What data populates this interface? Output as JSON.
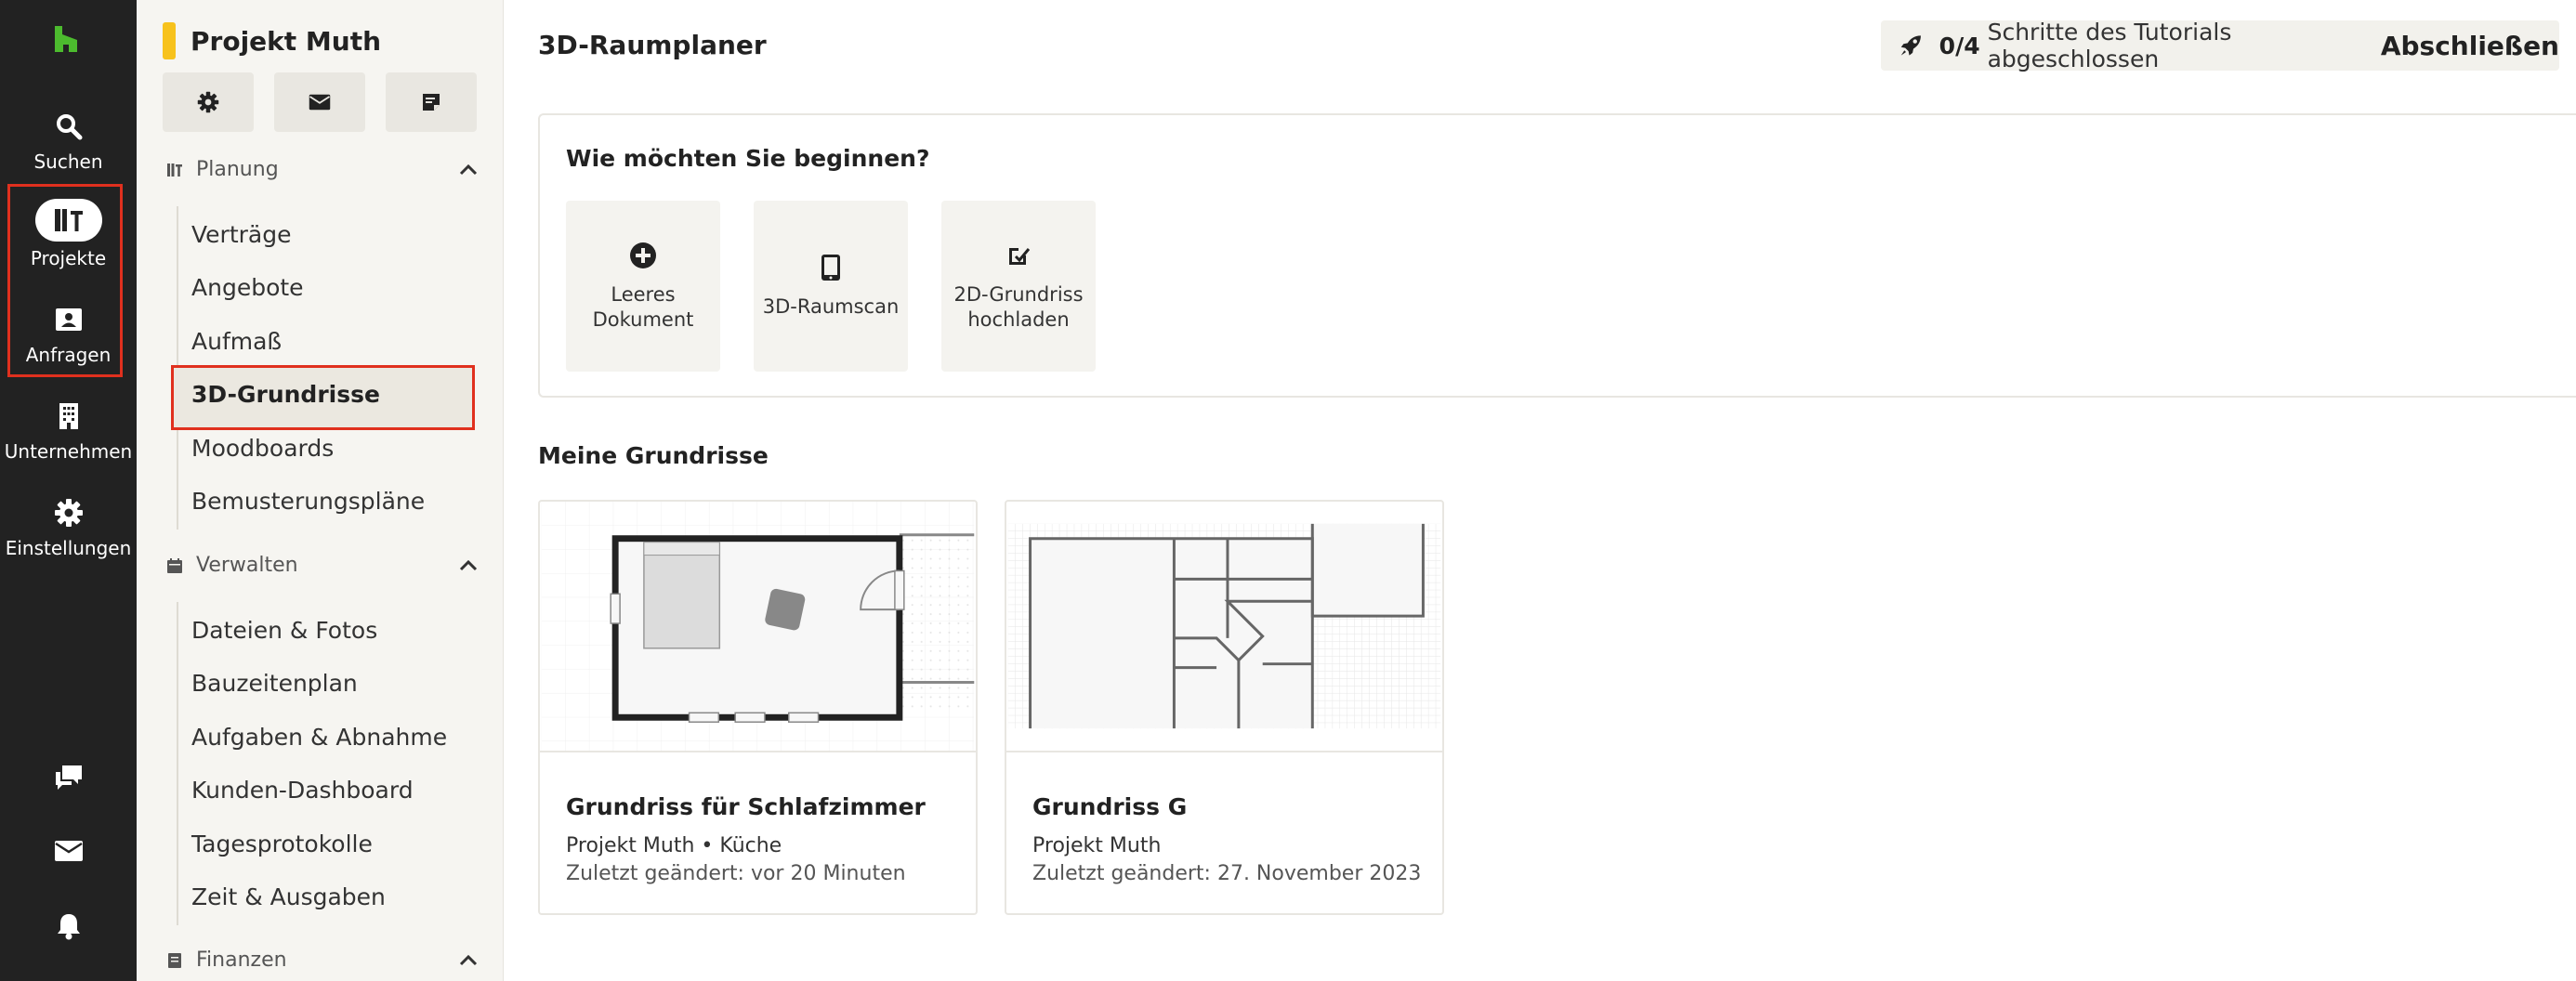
{
  "rail": {
    "items": [
      {
        "label": "Suchen",
        "icon": "search-icon"
      },
      {
        "label": "Projekte",
        "icon": "projects-icon"
      },
      {
        "label": "Anfragen",
        "icon": "inbox-person-icon"
      },
      {
        "label": "Unternehmen",
        "icon": "building-icon"
      },
      {
        "label": "Einstellungen",
        "icon": "gear-icon"
      }
    ],
    "bottom_icons": [
      "chat-icon",
      "mail-icon",
      "bell-icon"
    ],
    "logo_color": "#4cbb2e",
    "highlight_color": "#e0301e"
  },
  "sidebar": {
    "project_name": "Projekt Muth",
    "project_color": "#f7c21c",
    "sections": [
      {
        "title": "Planung",
        "items": [
          "Verträge",
          "Angebote",
          "Aufmaß",
          "3D-Grundrisse",
          "Moodboards",
          "Bemusterungspläne"
        ]
      },
      {
        "title": "Verwalten",
        "items": [
          "Dateien & Fotos",
          "Bauzeitenplan",
          "Aufgaben & Abnahme",
          "Kunden-Dashboard",
          "Tagesprotokolle",
          "Zeit & Ausgaben"
        ]
      },
      {
        "title": "Finanzen",
        "items": []
      }
    ],
    "active_item": "3D-Grundrisse"
  },
  "main": {
    "title": "3D-Raumplaner",
    "tutorial": {
      "count": "0/4",
      "text": "Schritte des Tutorials abgeschlossen",
      "finish": "Abschließen"
    },
    "start": {
      "title": "Wie möchten Sie beginnen?",
      "options": [
        {
          "label": "Leeres Dokument",
          "icon": "plus-circle-icon"
        },
        {
          "label": "3D-Raumscan",
          "icon": "tablet-icon"
        },
        {
          "label": "2D-Grundriss hochladen",
          "icon": "upload-plan-icon"
        }
      ]
    },
    "plans": {
      "title": "Meine Grundrisse",
      "cards": [
        {
          "name": "Grundriss für Schlafzimmer",
          "project": "Projekt Muth • Küche",
          "modified": "Zuletzt geändert: vor 20 Minuten"
        },
        {
          "name": "Grundriss G",
          "project": "Projekt Muth",
          "modified": "Zuletzt geändert: 27. November 2023"
        }
      ]
    }
  }
}
